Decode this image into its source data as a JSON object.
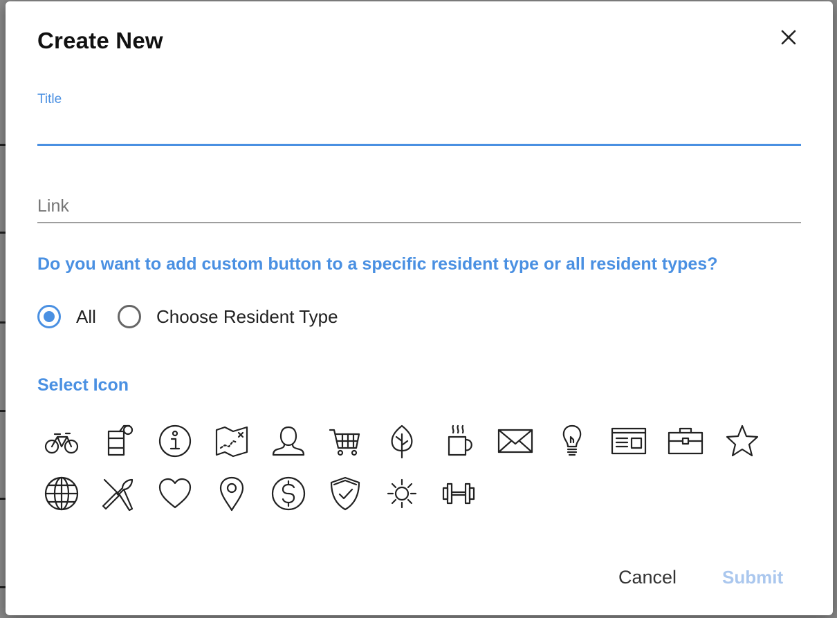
{
  "dialog": {
    "title": "Create New",
    "close_icon": "close-icon"
  },
  "form": {
    "title_label": "Title",
    "title_value": "",
    "link_placeholder": "Link",
    "link_value": "",
    "question": "Do you want to add custom button to a specific resident type or all resident types?",
    "radio_options": [
      {
        "label": "All",
        "selected": true
      },
      {
        "label": "Choose Resident Type",
        "selected": false
      }
    ],
    "select_icon_label": "Select Icon"
  },
  "icons": [
    "bicycle-icon",
    "drink-cup-icon",
    "info-icon",
    "map-icon",
    "person-icon",
    "shopping-cart-icon",
    "tree-icon",
    "coffee-mug-icon",
    "envelope-icon",
    "lightbulb-icon",
    "newspaper-icon",
    "briefcase-icon",
    "star-icon",
    "globe-icon",
    "fork-knife-icon",
    "heart-icon",
    "location-pin-icon",
    "dollar-icon",
    "shield-check-icon",
    "sun-icon",
    "dumbbell-icon"
  ],
  "actions": {
    "cancel_label": "Cancel",
    "submit_label": "Submit"
  },
  "colors": {
    "accent": "#4a90e2",
    "submit_disabled": "#aac7ee",
    "backdrop": "#8a8a8a"
  }
}
